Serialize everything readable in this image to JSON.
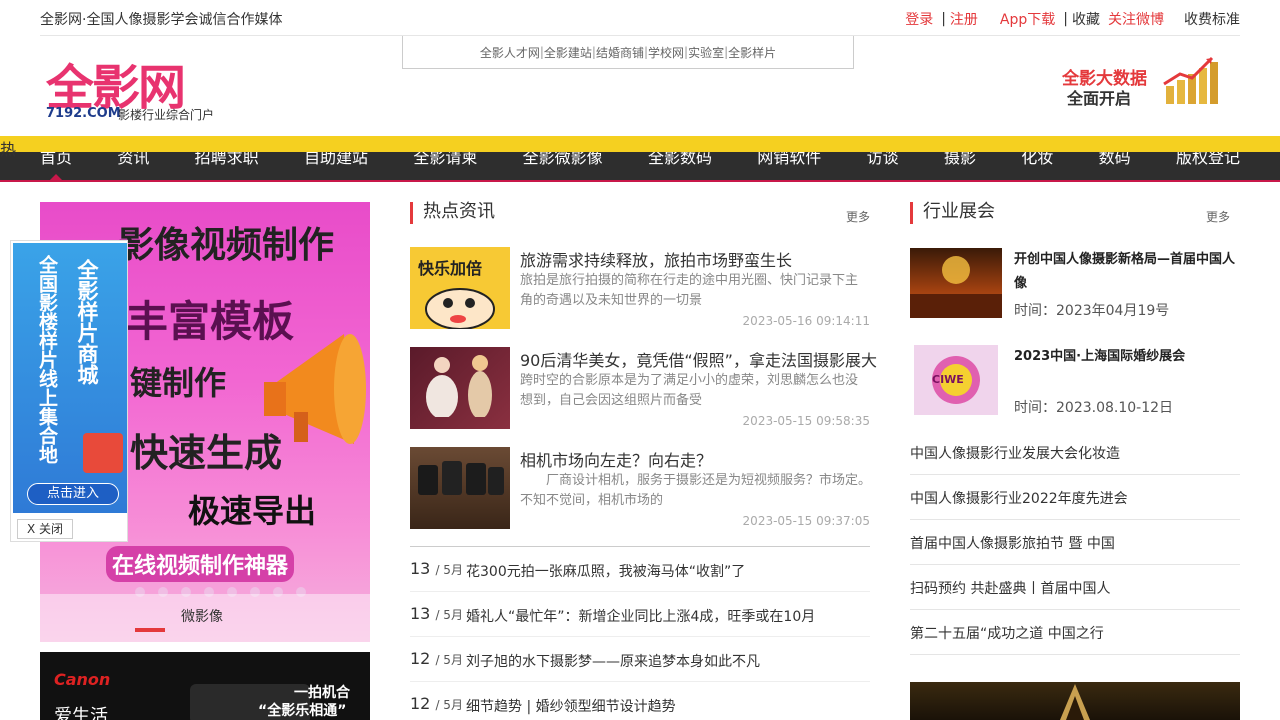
{
  "topbar": {
    "slogan": "全影网·全国人像摄影学会诚信合作媒体",
    "login": "登录",
    "register": "注册",
    "app": "App下载",
    "favorite": "收藏",
    "weibo": "关注微博",
    "fees": "收费标准",
    "sep": "|"
  },
  "logo": {
    "main": "全影网",
    "domain": "7192.COM",
    "tagline": "影楼行业综合门户"
  },
  "sublinks": [
    "全影人才网",
    "全影建站",
    "结婚商铺",
    "学校网",
    "实验室",
    "全影样片"
  ],
  "bigdata": {
    "line1": "全影大数据",
    "line2": "全面开启"
  },
  "nav": [
    "首页",
    "资讯",
    "招聘求职",
    "自助建站",
    "全影请柬",
    "全影微影像",
    "全影数码",
    "网销软件",
    "访谈",
    "摄影",
    "化妆",
    "数码",
    "版权登记"
  ],
  "nav_badge": "热",
  "banner": {
    "lines": [
      "影像视频制作",
      "丰富模板",
      "键制作",
      "快速生成",
      "极速导出",
      "在线视频制作神器"
    ],
    "caption": "微影像"
  },
  "float_ad": {
    "col1": "全国影楼样片线上集合地",
    "col2": "全影样片商城",
    "enter": "点击进入",
    "close": "X 关闭"
  },
  "canon_ad": {
    "brand": "Canon",
    "line1": "一拍机合",
    "line2": "“全影乐相通”",
    "left2": "爱生活"
  },
  "hot_news": {
    "title": "热点资讯",
    "more": "更多",
    "featured": [
      {
        "title": "旅游需求持续释放，旅拍市场野蛮生长",
        "desc": "旅拍是旅行拍摄的简称在行走的途中用光圈、快门记录下主角的奇遇以及未知世界的一切景",
        "time": "2023-05-16 09:14:11",
        "thumb_text": "快乐加倍"
      },
      {
        "title": "90后清华美女，竟凭借“假照”，拿走法国摄影展大",
        "desc": "跨时空的合影原本是为了满足小小的虚荣，刘思麟怎么也没想到，自己会因这组照片而备受",
        "time": "2023-05-15 09:58:35"
      },
      {
        "title": "相机市场向左走？向右走？",
        "desc": "　　厂商设计相机，服务于摄影还是为短视频服务？市场定。　　不知不觉间，相机市场的",
        "time": "2023-05-15 09:37:05"
      }
    ],
    "list": [
      {
        "day": "13",
        "month": "/ 5月",
        "title": "花300元拍一张麻瓜照，我被海马体“收割”了"
      },
      {
        "day": "13",
        "month": "/ 5月",
        "title": "婚礼人“最忙年”：新增企业同比上涨4成，旺季或在10月"
      },
      {
        "day": "12",
        "month": "/ 5月",
        "title": "刘子旭的水下摄影梦——原来追梦本身如此不凡"
      },
      {
        "day": "12",
        "month": "/ 5月",
        "title": "细节趋势 | 婚纱领型细节设计趋势"
      }
    ]
  },
  "expo": {
    "title": "行业展会",
    "more": "更多",
    "featured": [
      {
        "title": "开创中国人像摄影新格局—首届中国人像",
        "time": "时间：2023年04月19号"
      },
      {
        "title": "2023中国·上海国际婚纱展会",
        "time": "时间：2023.08.10-12日",
        "logo_text": "CIWE"
      }
    ],
    "list": [
      "中国人像摄影行业发展大会化妆造",
      "中国人像摄影行业2022年度先进会",
      "首届中国人像摄影旅拍节 暨 中国",
      "扫码预约 共赴盛典丨首届中国人",
      "第二十五届“成功之道 中国之行"
    ]
  },
  "colors": {
    "accent": "#e4393c",
    "nav_bg": "#2e2e2e",
    "nav_border": "#c8184a",
    "logo_pink": "#e8336f"
  }
}
